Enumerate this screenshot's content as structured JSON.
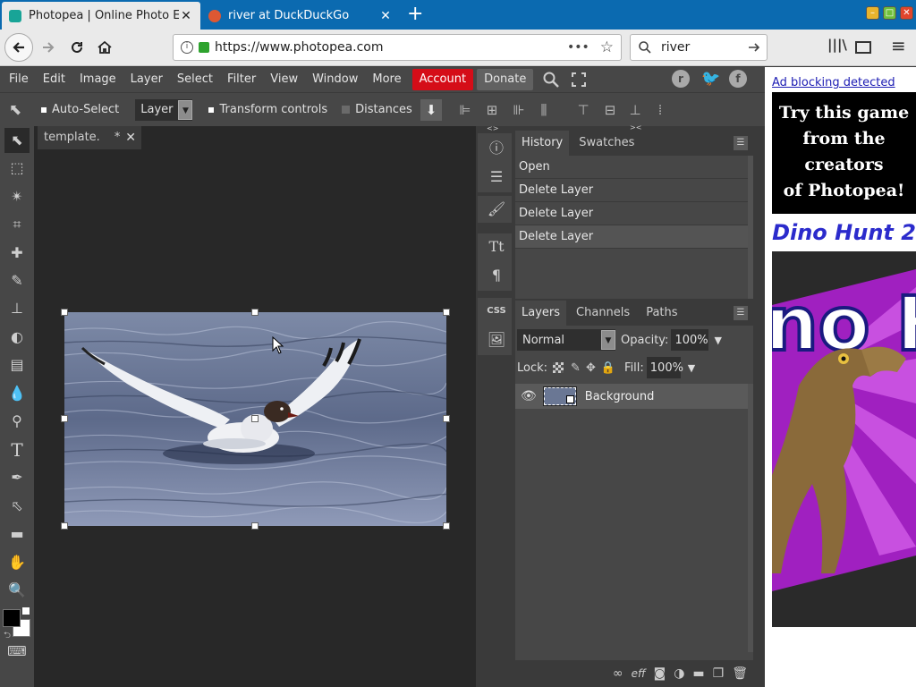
{
  "browser": {
    "tabs": [
      {
        "title": "Photopea | Online Photo Editor",
        "active": true,
        "favicon_color": "#18a497"
      },
      {
        "title": "river at DuckDuckGo",
        "active": false,
        "favicon_color": "#de5833"
      }
    ],
    "new_tab": "+",
    "url": "https://www.photopea.com",
    "search_value": "river",
    "page_actions": "•••"
  },
  "menu": {
    "items": [
      "File",
      "Edit",
      "Image",
      "Layer",
      "Select",
      "Filter",
      "View",
      "Window",
      "More"
    ],
    "account": "Account",
    "donate": "Donate"
  },
  "options": {
    "auto_select": "Auto-Select",
    "target": "Layer",
    "transform_controls": "Transform controls",
    "distances": "Distances"
  },
  "document": {
    "tab_title": "template.",
    "modified_marker": "*"
  },
  "history": {
    "tabs": [
      "History",
      "Swatches"
    ],
    "items": [
      "Open",
      "Delete Layer",
      "Delete Layer",
      "Delete Layer"
    ]
  },
  "layers": {
    "tabs": [
      "Layers",
      "Channels",
      "Paths"
    ],
    "blend_mode": "Normal",
    "opacity_label": "Opacity:",
    "opacity": "100%",
    "lock_label": "Lock:",
    "fill_label": "Fill:",
    "fill": "100%",
    "items": [
      {
        "name": "Background",
        "visible": true
      }
    ],
    "footer_icons": [
      "link-icon",
      "effects-icon",
      "mask-icon",
      "adjustment-icon",
      "folder-icon",
      "new-layer-icon",
      "trash-icon"
    ],
    "effects_glyph": "eff"
  },
  "mini_panel": {
    "css_label": "CSS"
  },
  "ad": {
    "blocking_text": "Ad blocking detected",
    "headline": [
      "Try this game",
      "from the",
      "creators",
      "of Photopea!"
    ],
    "game_title": "Dino Hunt 2"
  },
  "colors": {
    "accent_account": "#d50d18",
    "browser_tabbar": "#0b6ab0",
    "app_bg": "#474747",
    "canvas_bg": "#282828",
    "foreground": "#000000",
    "background": "#ffffff"
  }
}
